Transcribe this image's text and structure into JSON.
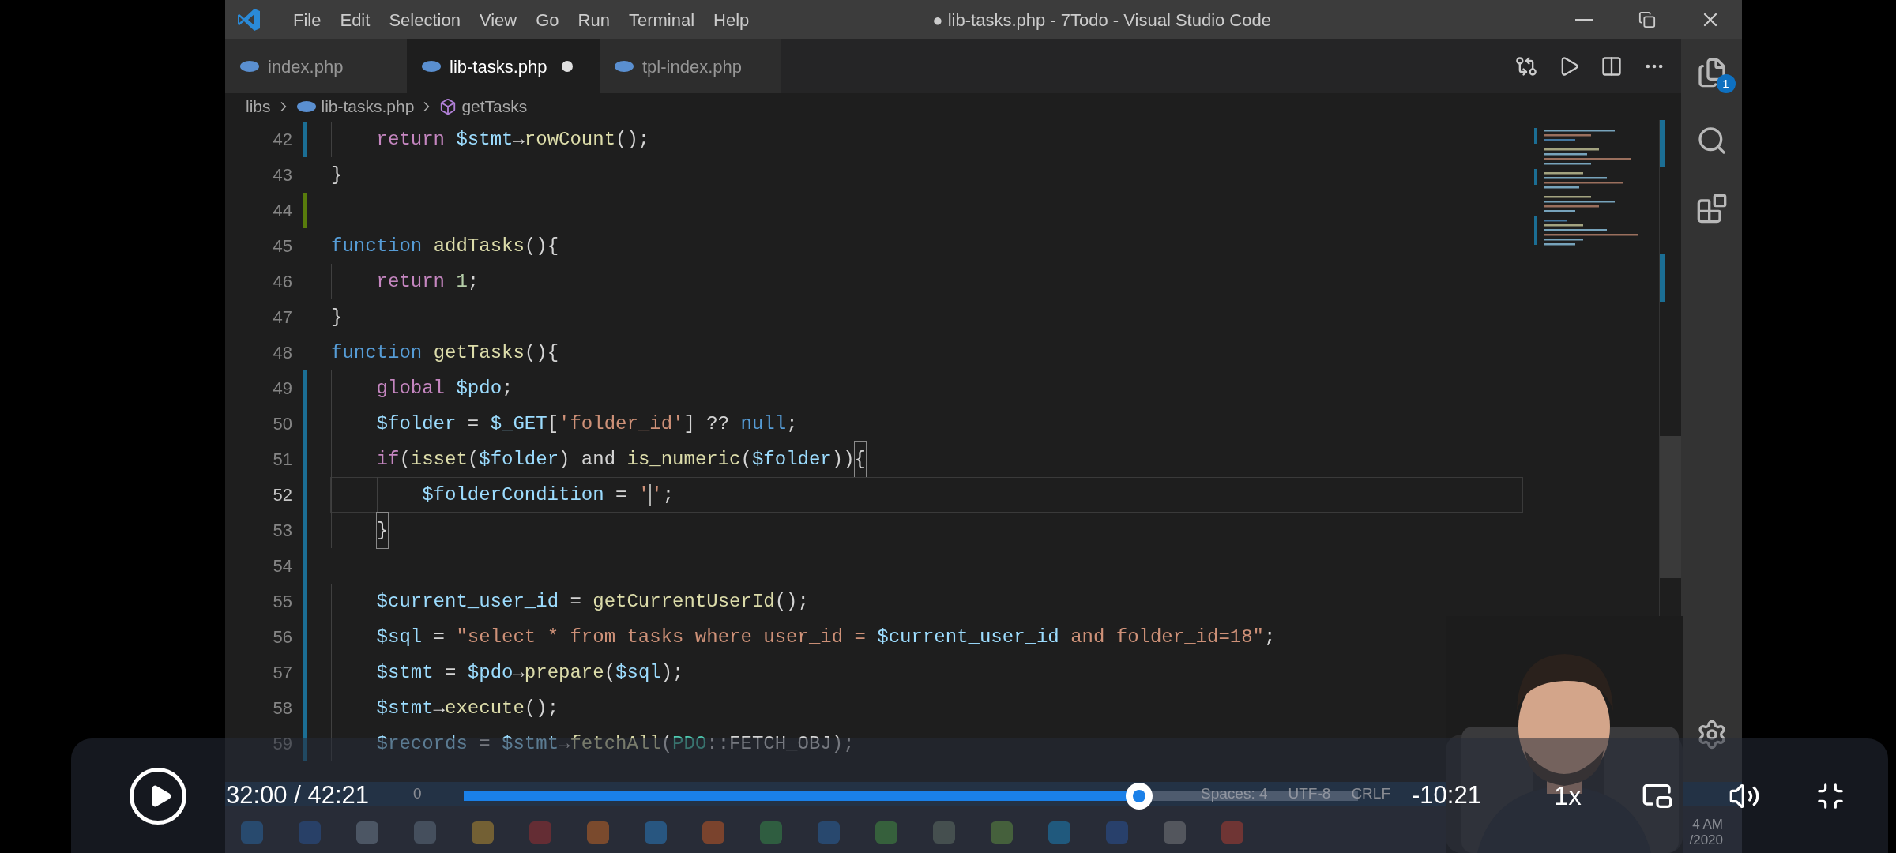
{
  "title_bar": {
    "menu": [
      "File",
      "Edit",
      "Selection",
      "View",
      "Go",
      "Run",
      "Terminal",
      "Help"
    ],
    "title": "● lib-tasks.php - 7Todo - Visual Studio Code"
  },
  "tabs": [
    {
      "label": "index.php",
      "selected": false,
      "modified": false
    },
    {
      "label": "lib-tasks.php",
      "selected": true,
      "modified": true
    },
    {
      "label": "tpl-index.php",
      "selected": false,
      "modified": false
    }
  ],
  "breadcrumb": [
    {
      "kind": "folder",
      "label": "libs"
    },
    {
      "kind": "file",
      "label": "lib-tasks.php"
    },
    {
      "kind": "symbol",
      "label": "getTasks"
    }
  ],
  "activity_bar": {
    "badge": "1"
  },
  "editor": {
    "lines": [
      {
        "number": "42",
        "modified": true,
        "added": false,
        "current": false,
        "kind": "block",
        "tokens": [
          {
            "kind": "ctrl",
            "text": "return "
          },
          {
            "kind": "var",
            "text": "$stmt"
          },
          {
            "kind": "punc",
            "text": "→"
          },
          {
            "kind": "fn",
            "text": "rowCount"
          },
          {
            "kind": "punc",
            "text": "();"
          }
        ]
      },
      {
        "number": "43",
        "modified": false,
        "added": false,
        "current": false,
        "tokens": [
          {
            "kind": "punc",
            "text": "}"
          }
        ]
      },
      {
        "number": "44",
        "modified": false,
        "added": true,
        "current": false
      },
      {
        "number": "45",
        "modified": false,
        "added": false,
        "current": false,
        "tokens": [
          {
            "kind": "kw",
            "text": "function "
          },
          {
            "kind": "fn",
            "text": "addTasks"
          },
          {
            "kind": "punc",
            "text": "(){"
          }
        ]
      },
      {
        "number": "46",
        "modified": false,
        "added": false,
        "current": false,
        "kind": "block",
        "tokens": [
          {
            "kind": "ctrl",
            "text": "return "
          },
          {
            "kind": "num",
            "text": "1"
          },
          {
            "kind": "punc",
            "text": ";"
          }
        ]
      },
      {
        "number": "47",
        "modified": false,
        "added": false,
        "current": false,
        "tokens": [
          {
            "kind": "punc",
            "text": "}"
          }
        ]
      },
      {
        "number": "48",
        "modified": false,
        "added": false,
        "current": false,
        "tokens": [
          {
            "kind": "kw",
            "text": "function "
          },
          {
            "kind": "fn",
            "text": "getTasks"
          },
          {
            "kind": "punc",
            "text": "(){"
          }
        ]
      },
      {
        "number": "49",
        "modified": true,
        "added": false,
        "current": false,
        "kind": "block",
        "tokens": [
          {
            "kind": "ctrl",
            "text": "global "
          },
          {
            "kind": "var",
            "text": "$pdo"
          },
          {
            "kind": "punc",
            "text": ";"
          }
        ]
      },
      {
        "number": "50",
        "modified": true,
        "added": false,
        "current": false,
        "kind": "block",
        "tokens": [
          {
            "kind": "var",
            "text": "$folder"
          },
          {
            "kind": "punc",
            "text": " = "
          },
          {
            "kind": "var",
            "text": "$_GET"
          },
          {
            "kind": "punc",
            "text": "["
          },
          {
            "kind": "str",
            "text": "'folder_id'"
          },
          {
            "kind": "punc",
            "text": "] ?? "
          },
          {
            "kind": "kw",
            "text": "null"
          },
          {
            "kind": "punc",
            "text": ";"
          }
        ]
      },
      {
        "number": "51",
        "modified": true,
        "added": false,
        "current": false,
        "kind": "block",
        "tokens": [
          {
            "kind": "ctrl",
            "text": "if"
          },
          {
            "kind": "punc",
            "text": "("
          },
          {
            "kind": "fn",
            "text": "isset"
          },
          {
            "kind": "punc",
            "text": "("
          },
          {
            "kind": "var",
            "text": "$folder"
          },
          {
            "kind": "punc",
            "text": ") and "
          },
          {
            "kind": "fn",
            "text": "is_numeric"
          },
          {
            "kind": "punc",
            "text": "("
          },
          {
            "kind": "var",
            "text": "$folder"
          },
          {
            "kind": "punc",
            "text": "))"
          },
          {
            "kind": "bracket",
            "text": "{"
          }
        ]
      },
      {
        "number": "52",
        "modified": true,
        "added": false,
        "current": true,
        "kind": "nested",
        "tokens": [
          {
            "kind": "var",
            "text": "$folderCondition"
          },
          {
            "kind": "punc",
            "text": " = "
          },
          {
            "kind": "str",
            "text": "'"
          },
          {
            "kind": "cursor"
          },
          {
            "kind": "str",
            "text": "'"
          },
          {
            "kind": "punc",
            "text": ";"
          }
        ]
      },
      {
        "number": "53",
        "modified": true,
        "added": false,
        "current": false,
        "kind": "block",
        "tokens": [
          {
            "kind": "bracket",
            "text": "}"
          }
        ]
      },
      {
        "number": "54",
        "modified": true,
        "added": false,
        "current": false
      },
      {
        "number": "55",
        "modified": true,
        "added": false,
        "current": false,
        "kind": "block",
        "tokens": [
          {
            "kind": "var",
            "text": "$current_user_id"
          },
          {
            "kind": "punc",
            "text": " = "
          },
          {
            "kind": "fn",
            "text": "getCurrentUserId"
          },
          {
            "kind": "punc",
            "text": "();"
          }
        ]
      },
      {
        "number": "56",
        "modified": true,
        "added": false,
        "current": false,
        "kind": "block",
        "tokens": [
          {
            "kind": "var",
            "text": "$sql"
          },
          {
            "kind": "punc",
            "text": " = "
          },
          {
            "kind": "str",
            "text": "\"select * from tasks where user_id = "
          },
          {
            "kind": "var",
            "text": "$current_user_id"
          },
          {
            "kind": "str",
            "text": " and folder_id=18\""
          },
          {
            "kind": "punc",
            "text": ";"
          }
        ]
      },
      {
        "number": "57",
        "modified": true,
        "added": false,
        "current": false,
        "kind": "block",
        "tokens": [
          {
            "kind": "var",
            "text": "$stmt"
          },
          {
            "kind": "punc",
            "text": " = "
          },
          {
            "kind": "var",
            "text": "$pdo"
          },
          {
            "kind": "punc",
            "text": "→"
          },
          {
            "kind": "fn",
            "text": "prepare"
          },
          {
            "kind": "punc",
            "text": "("
          },
          {
            "kind": "var",
            "text": "$sql"
          },
          {
            "kind": "punc",
            "text": ");"
          }
        ]
      },
      {
        "number": "58",
        "modified": true,
        "added": false,
        "current": false,
        "kind": "block",
        "tokens": [
          {
            "kind": "var",
            "text": "$stmt"
          },
          {
            "kind": "punc",
            "text": "→"
          },
          {
            "kind": "fn",
            "text": "execute"
          },
          {
            "kind": "punc",
            "text": "();"
          }
        ]
      },
      {
        "number": "59",
        "modified": true,
        "added": false,
        "current": false,
        "kind": "block",
        "tokens": [
          {
            "kind": "var",
            "text": "$records"
          },
          {
            "kind": "punc",
            "text": " = "
          },
          {
            "kind": "var",
            "text": "$stmt"
          },
          {
            "kind": "punc",
            "text": "→"
          },
          {
            "kind": "fn",
            "text": "fetchAll"
          },
          {
            "kind": "punc",
            "text": "("
          },
          {
            "kind": "type",
            "text": "PDO"
          },
          {
            "kind": "punc",
            "text": "::FETCH_OBJ);"
          }
        ]
      }
    ]
  },
  "status_bar": {
    "left_items": [
      "0"
    ],
    "right_items": [
      "Spaces: 4",
      "UTF-8",
      "CRLF"
    ]
  },
  "taskbar": {
    "clock_time": "4 AM",
    "clock_date": "/2020"
  },
  "player": {
    "playing": false,
    "elapsed": "32:00 / 42:21",
    "level": 0.755,
    "remaining": "-10:21",
    "speed": "1x"
  }
}
